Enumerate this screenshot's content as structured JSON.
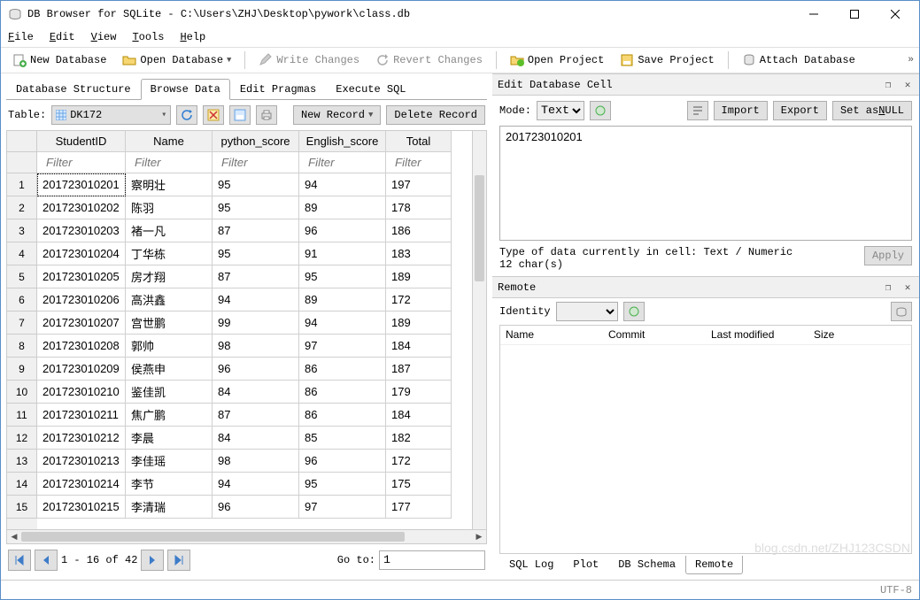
{
  "window": {
    "title": "DB Browser for SQLite - C:\\Users\\ZHJ\\Desktop\\pywork\\class.db"
  },
  "menu": {
    "file": "File",
    "edit": "Edit",
    "view": "View",
    "tools": "Tools",
    "help": "Help"
  },
  "toolbar": {
    "new_db": "New Database",
    "open_db": "Open Database",
    "write": "Write Changes",
    "revert": "Revert Changes",
    "open_proj": "Open Project",
    "save_proj": "Save Project",
    "attach": "Attach Database"
  },
  "tabs": {
    "structure": "Database Structure",
    "browse": "Browse Data",
    "pragmas": "Edit Pragmas",
    "sql": "Execute SQL"
  },
  "browse": {
    "table_lbl": "Table:",
    "table_sel": "DK172",
    "new_record": "New Record",
    "delete_record": "Delete Record",
    "columns": [
      "StudentID",
      "Name",
      "python_score",
      "English_score",
      "Total"
    ],
    "filter_ph": "Filter",
    "rows": [
      [
        "201723010201",
        "察明壮",
        "95",
        "94",
        "197"
      ],
      [
        "201723010202",
        "陈羽",
        "95",
        "89",
        "178"
      ],
      [
        "201723010203",
        "褚一凡",
        "87",
        "96",
        "186"
      ],
      [
        "201723010204",
        "丁华栋",
        "95",
        "91",
        "183"
      ],
      [
        "201723010205",
        "房才翔",
        "87",
        "95",
        "189"
      ],
      [
        "201723010206",
        "高洪鑫",
        "94",
        "89",
        "172"
      ],
      [
        "201723010207",
        "宫世鹏",
        "99",
        "94",
        "189"
      ],
      [
        "201723010208",
        "郭帅",
        "98",
        "97",
        "184"
      ],
      [
        "201723010209",
        "侯燕申",
        "96",
        "86",
        "187"
      ],
      [
        "201723010210",
        "鉴佳凯",
        "84",
        "86",
        "179"
      ],
      [
        "201723010211",
        "焦广鹏",
        "87",
        "86",
        "184"
      ],
      [
        "201723010212",
        "李晨",
        "84",
        "85",
        "182"
      ],
      [
        "201723010213",
        "李佳瑶",
        "98",
        "96",
        "172"
      ],
      [
        "201723010214",
        "李节",
        "94",
        "95",
        "175"
      ],
      [
        "201723010215",
        "李清瑞",
        "96",
        "97",
        "177"
      ]
    ],
    "nav_text": "1 - 16 of 42",
    "goto_lbl": "Go to:",
    "goto_val": "1"
  },
  "editcell": {
    "title": "Edit Database Cell",
    "mode_lbl": "Mode:",
    "mode_val": "Text",
    "import": "Import",
    "export": "Export",
    "setnull": "Set as NULL",
    "content": "201723010201",
    "type_line": "Type of data currently in cell: Text / Numeric",
    "chars": "12 char(s)",
    "apply": "Apply"
  },
  "remote": {
    "title": "Remote",
    "identity_lbl": "Identity",
    "cols": {
      "name": "Name",
      "commit": "Commit",
      "modified": "Last modified",
      "size": "Size"
    }
  },
  "bottom_tabs": {
    "sqllog": "SQL Log",
    "plot": "Plot",
    "schema": "DB Schema",
    "remote": "Remote"
  },
  "status": "UTF-8",
  "watermark": "blog.csdn.net/ZHJ123CSDN"
}
